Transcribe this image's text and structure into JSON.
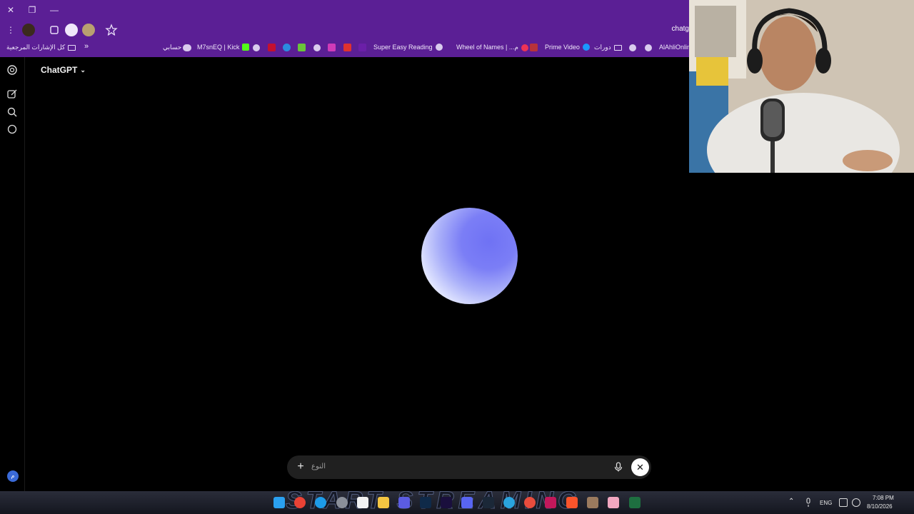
{
  "window": {
    "controls": [
      "close",
      "restore",
      "minimize"
    ]
  },
  "toolbar": {
    "url_partial": "chatg"
  },
  "bookmarks": {
    "all_bookmarks": "كل الإشارات المرجعية",
    "more_glyph": "»",
    "items": [
      "حسابي",
      "M7snEQ | Kick",
      "Super Easy Reading",
      "Wheel of Names | ...م",
      "Prime Video",
      "دورات",
      "AlAhliOnline"
    ]
  },
  "app": {
    "model_label": "ChatGPT",
    "avatar_letter": "م",
    "composer": {
      "placeholder": "النوع",
      "plus_glyph": "+",
      "close_glyph": "✕"
    }
  },
  "taskbar": {
    "banner_text": "START STREAMING",
    "language": "ENG",
    "time": "7:08 PM",
    "date": "8/10/2026"
  },
  "colors": {
    "browser_frame": "#5b1f95",
    "background": "#000000",
    "orb_primary": "#6f72f4"
  }
}
